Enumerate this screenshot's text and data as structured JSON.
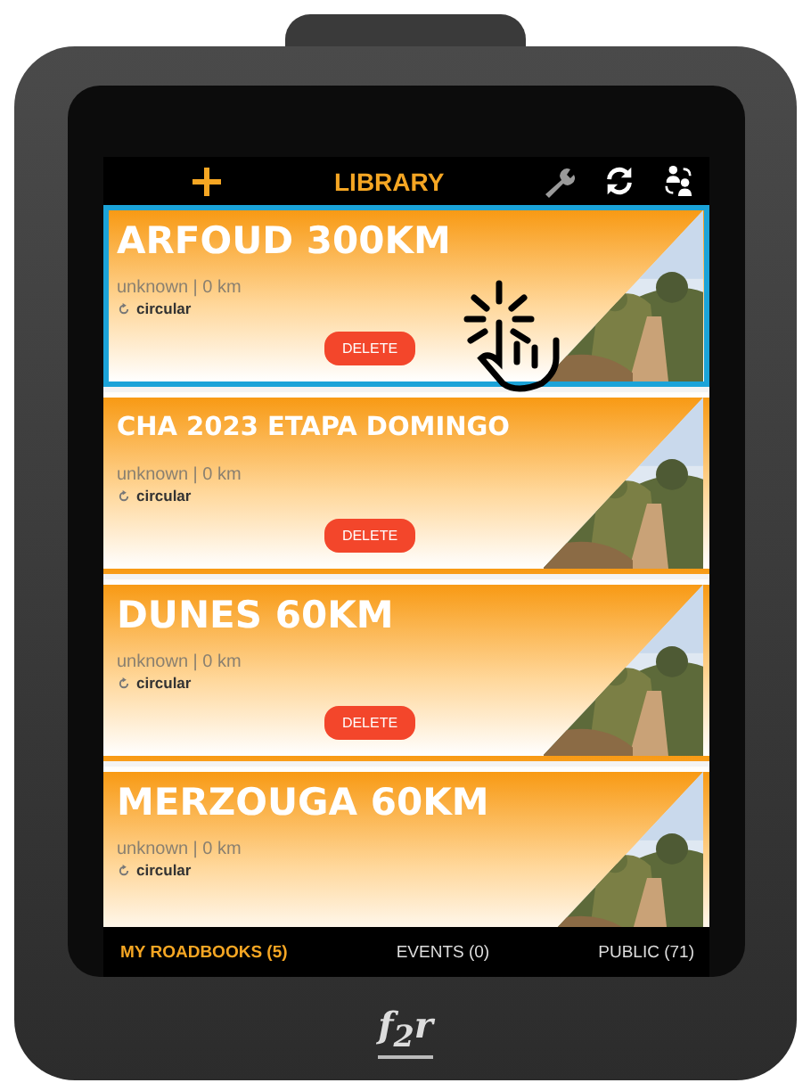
{
  "header": {
    "title": "LIBRARY"
  },
  "roadbooks": [
    {
      "title": "ARFOUD 300KM",
      "meta": "unknown | 0 km",
      "route": "circular",
      "delete": "DELETE",
      "selected": true
    },
    {
      "title": "CHA 2023 ETAPA DOMINGO",
      "meta": "unknown | 0 km",
      "route": "circular",
      "delete": "DELETE",
      "selected": false
    },
    {
      "title": "DUNES 60KM",
      "meta": "unknown | 0 km",
      "route": "circular",
      "delete": "DELETE",
      "selected": false
    },
    {
      "title": "MERZOUGA 60KM",
      "meta": "unknown | 0 km",
      "route": "circular",
      "selected": false
    }
  ],
  "tabs": [
    {
      "label": "MY ROADBOOKS (5)",
      "selected": true
    },
    {
      "label": "EVENTS (0)",
      "selected": false
    },
    {
      "label": "PUBLIC (71)",
      "selected": false
    }
  ],
  "logo": "f$_{2}$r"
}
